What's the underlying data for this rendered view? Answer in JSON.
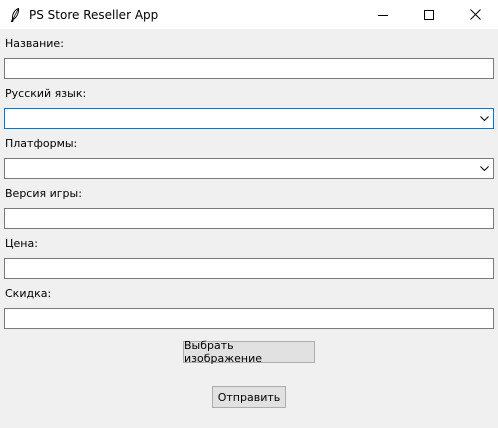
{
  "window": {
    "title": "PS Store Reseller App",
    "icon": "feather-icon",
    "controls": [
      "minimize-icon",
      "maximize-icon",
      "close-icon"
    ]
  },
  "form": {
    "name_label": "Название:",
    "name_value": "",
    "russian_label": "Русский язык:",
    "russian_value": "",
    "platforms_label": "Платформы:",
    "platforms_value": "",
    "version_label": "Версия игры:",
    "version_value": "",
    "price_label": "Цена:",
    "price_value": "",
    "discount_label": "Скидка:",
    "discount_value": ""
  },
  "buttons": {
    "choose_image": "Выбрать изображение",
    "submit": "Отправить"
  },
  "colors": {
    "window_bg": "#f0f0f0",
    "focus_border": "#0078d7",
    "field_border": "#7a7a7a",
    "button_bg": "#e1e1e1"
  }
}
